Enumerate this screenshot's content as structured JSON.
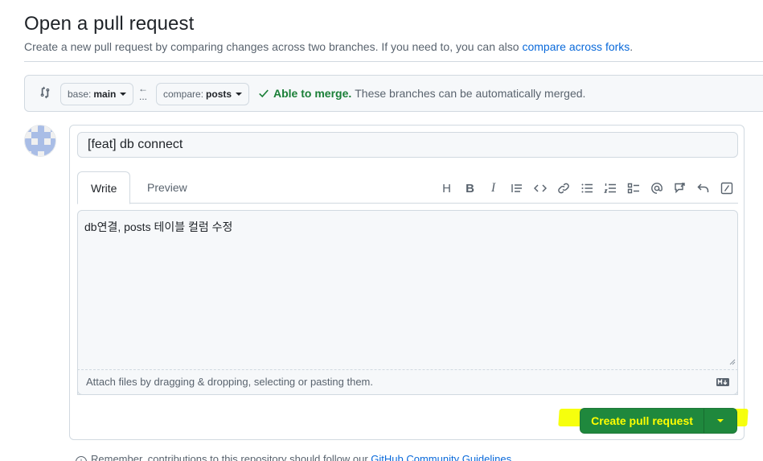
{
  "header": {
    "title": "Open a pull request",
    "subtitle_prefix": "Create a new pull request by comparing changes across two branches. If you need to, you can also ",
    "subtitle_link": "compare across forks",
    "subtitle_suffix": "."
  },
  "compare": {
    "base_prefix": "base:",
    "base_value": "main",
    "compare_prefix": "compare:",
    "compare_value": "posts",
    "arrow_symbol": "←",
    "dots_symbol": "...",
    "merge_ok": "Able to merge.",
    "merge_text": "These branches can be automatically merged."
  },
  "form": {
    "title_value": "[feat] db connect",
    "tabs": [
      "Write",
      "Preview"
    ],
    "toolbar_icons": [
      "heading-icon",
      "bold-icon",
      "italic-icon",
      "quote-icon",
      "code-icon",
      "link-icon",
      "unordered-list-icon",
      "ordered-list-icon",
      "task-list-icon",
      "mention-icon",
      "reference-icon",
      "undo-icon",
      "slash-command-icon"
    ],
    "toolbar_labels": [
      "H",
      "B",
      "I"
    ],
    "body_text": "db연결, posts 테이블 컬럼 수정",
    "attach_text": "Attach files by dragging & dropping, selecting or pasting them."
  },
  "actions": {
    "create_label": "Create pull request"
  },
  "footer": {
    "prefix": "Remember, contributions to this repository should follow our ",
    "link": "GitHub Community Guidelines",
    "info_symbol": "!"
  },
  "colors": {
    "accent": "#0969da",
    "success": "#1a7f37",
    "button": "#1f883d",
    "highlight": "#f5ff00"
  }
}
